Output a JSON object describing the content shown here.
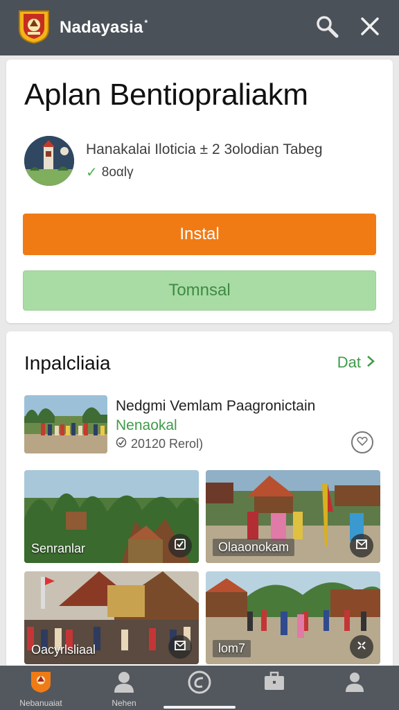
{
  "appbar": {
    "title": "Nadayasia",
    "title_mark": "*",
    "icons": {
      "logo": "emblem-logo",
      "search": "search-icon",
      "close": "close-icon"
    },
    "bg_color": "#4b5159"
  },
  "app_card": {
    "title": "Aplan Bentiopraliakm",
    "developer": "Hanakalai Iloticia ± 2 3olodian Tabeg",
    "rating_text": "8oαlγ",
    "install_label": "Instal",
    "secondary_label": "Tomnsal",
    "accent_color": "#f07b15",
    "secondary_color": "#a8dca4"
  },
  "gallery": {
    "title": "Inpalcliaia",
    "link_label": "Dat",
    "featured": {
      "title": "Nedgmi Vemlam Paagronictain",
      "subtitle": "Nenaokal",
      "meta": "20120 Rerol)"
    },
    "tiles": [
      {
        "label": "Senranlar"
      },
      {
        "label": "Olaaonokam"
      },
      {
        "label": "Oacyrlsliaal"
      },
      {
        "label": "lom7"
      }
    ]
  },
  "bottom_nav": {
    "items": [
      {
        "label": "Nebanuaiat",
        "icon": "emblem-icon"
      },
      {
        "label": "Nehen",
        "icon": "person-icon"
      },
      {
        "label": "",
        "icon": "compass-icon"
      },
      {
        "label": "",
        "icon": "briefcase-icon"
      },
      {
        "label": "",
        "icon": "profile-icon"
      }
    ]
  }
}
